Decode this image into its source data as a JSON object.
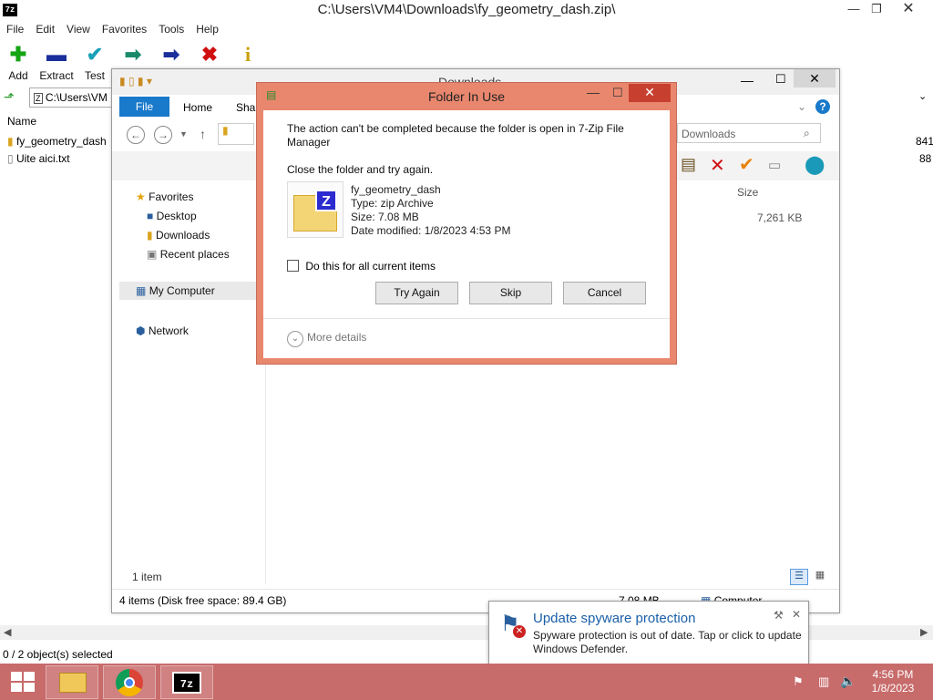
{
  "zip": {
    "title": "C:\\Users\\VM4\\Downloads\\fy_geometry_dash.zip\\",
    "menu": [
      "File",
      "Edit",
      "View",
      "Favorites",
      "Tools",
      "Help"
    ],
    "toolbar": [
      {
        "label": "Add",
        "icon": "add-icon"
      },
      {
        "label": "Extract",
        "icon": "extract-icon"
      },
      {
        "label": "Test",
        "icon": "test-icon"
      },
      {
        "label": "",
        "icon": "copy-icon"
      },
      {
        "label": "",
        "icon": "move-icon"
      },
      {
        "label": "",
        "icon": "delete-icon"
      },
      {
        "label": "",
        "icon": "info-icon"
      }
    ],
    "address": "C:\\Users\\VM",
    "col_name": "Name",
    "files": [
      {
        "name": "fy_geometry_dash",
        "size": "841"
      },
      {
        "name": "Uite aici.txt",
        "size": "88"
      }
    ],
    "status": "0 / 2 object(s) selected"
  },
  "explorer": {
    "title": "Downloads",
    "tabs": [
      "File",
      "Home",
      "Shar"
    ],
    "search_placeholder": "Downloads",
    "sidebar": {
      "favorites": "Favorites",
      "desktop": "Desktop",
      "downloads": "Downloads",
      "recent": "Recent places",
      "computer": "My Computer",
      "network": "Network"
    },
    "col_size": "Size",
    "file_size": "7,261 KB",
    "item_count": "1 item",
    "bottom_status": "4 items (Disk free space: 89.4 GB)",
    "bottom_size": "7.08 MB",
    "bottom_location": "Computer"
  },
  "dialog": {
    "title": "Folder In Use",
    "message": "The action can't be completed because the folder is open in 7-Zip File Manager",
    "instruction": "Close the folder and try again.",
    "file_name": "fy_geometry_dash",
    "file_type": "Type: zip Archive",
    "file_size": "Size: 7.08 MB",
    "file_date": "Date modified: 1/8/2023 4:53 PM",
    "checkbox_label": "Do this for all current items",
    "btn_try": "Try Again",
    "btn_skip": "Skip",
    "btn_cancel": "Cancel",
    "more_details": "More details"
  },
  "toast": {
    "title": "Update spyware protection",
    "body": "Spyware protection is out of date. Tap or click to update Windows Defender."
  },
  "taskbar": {
    "time": "4:56 PM",
    "date": "1/8/2023"
  },
  "colors": {
    "accent": "#1979ca",
    "dialog_frame": "#e9876e",
    "taskbar": "#c86b6b",
    "close": "#c7402f"
  }
}
